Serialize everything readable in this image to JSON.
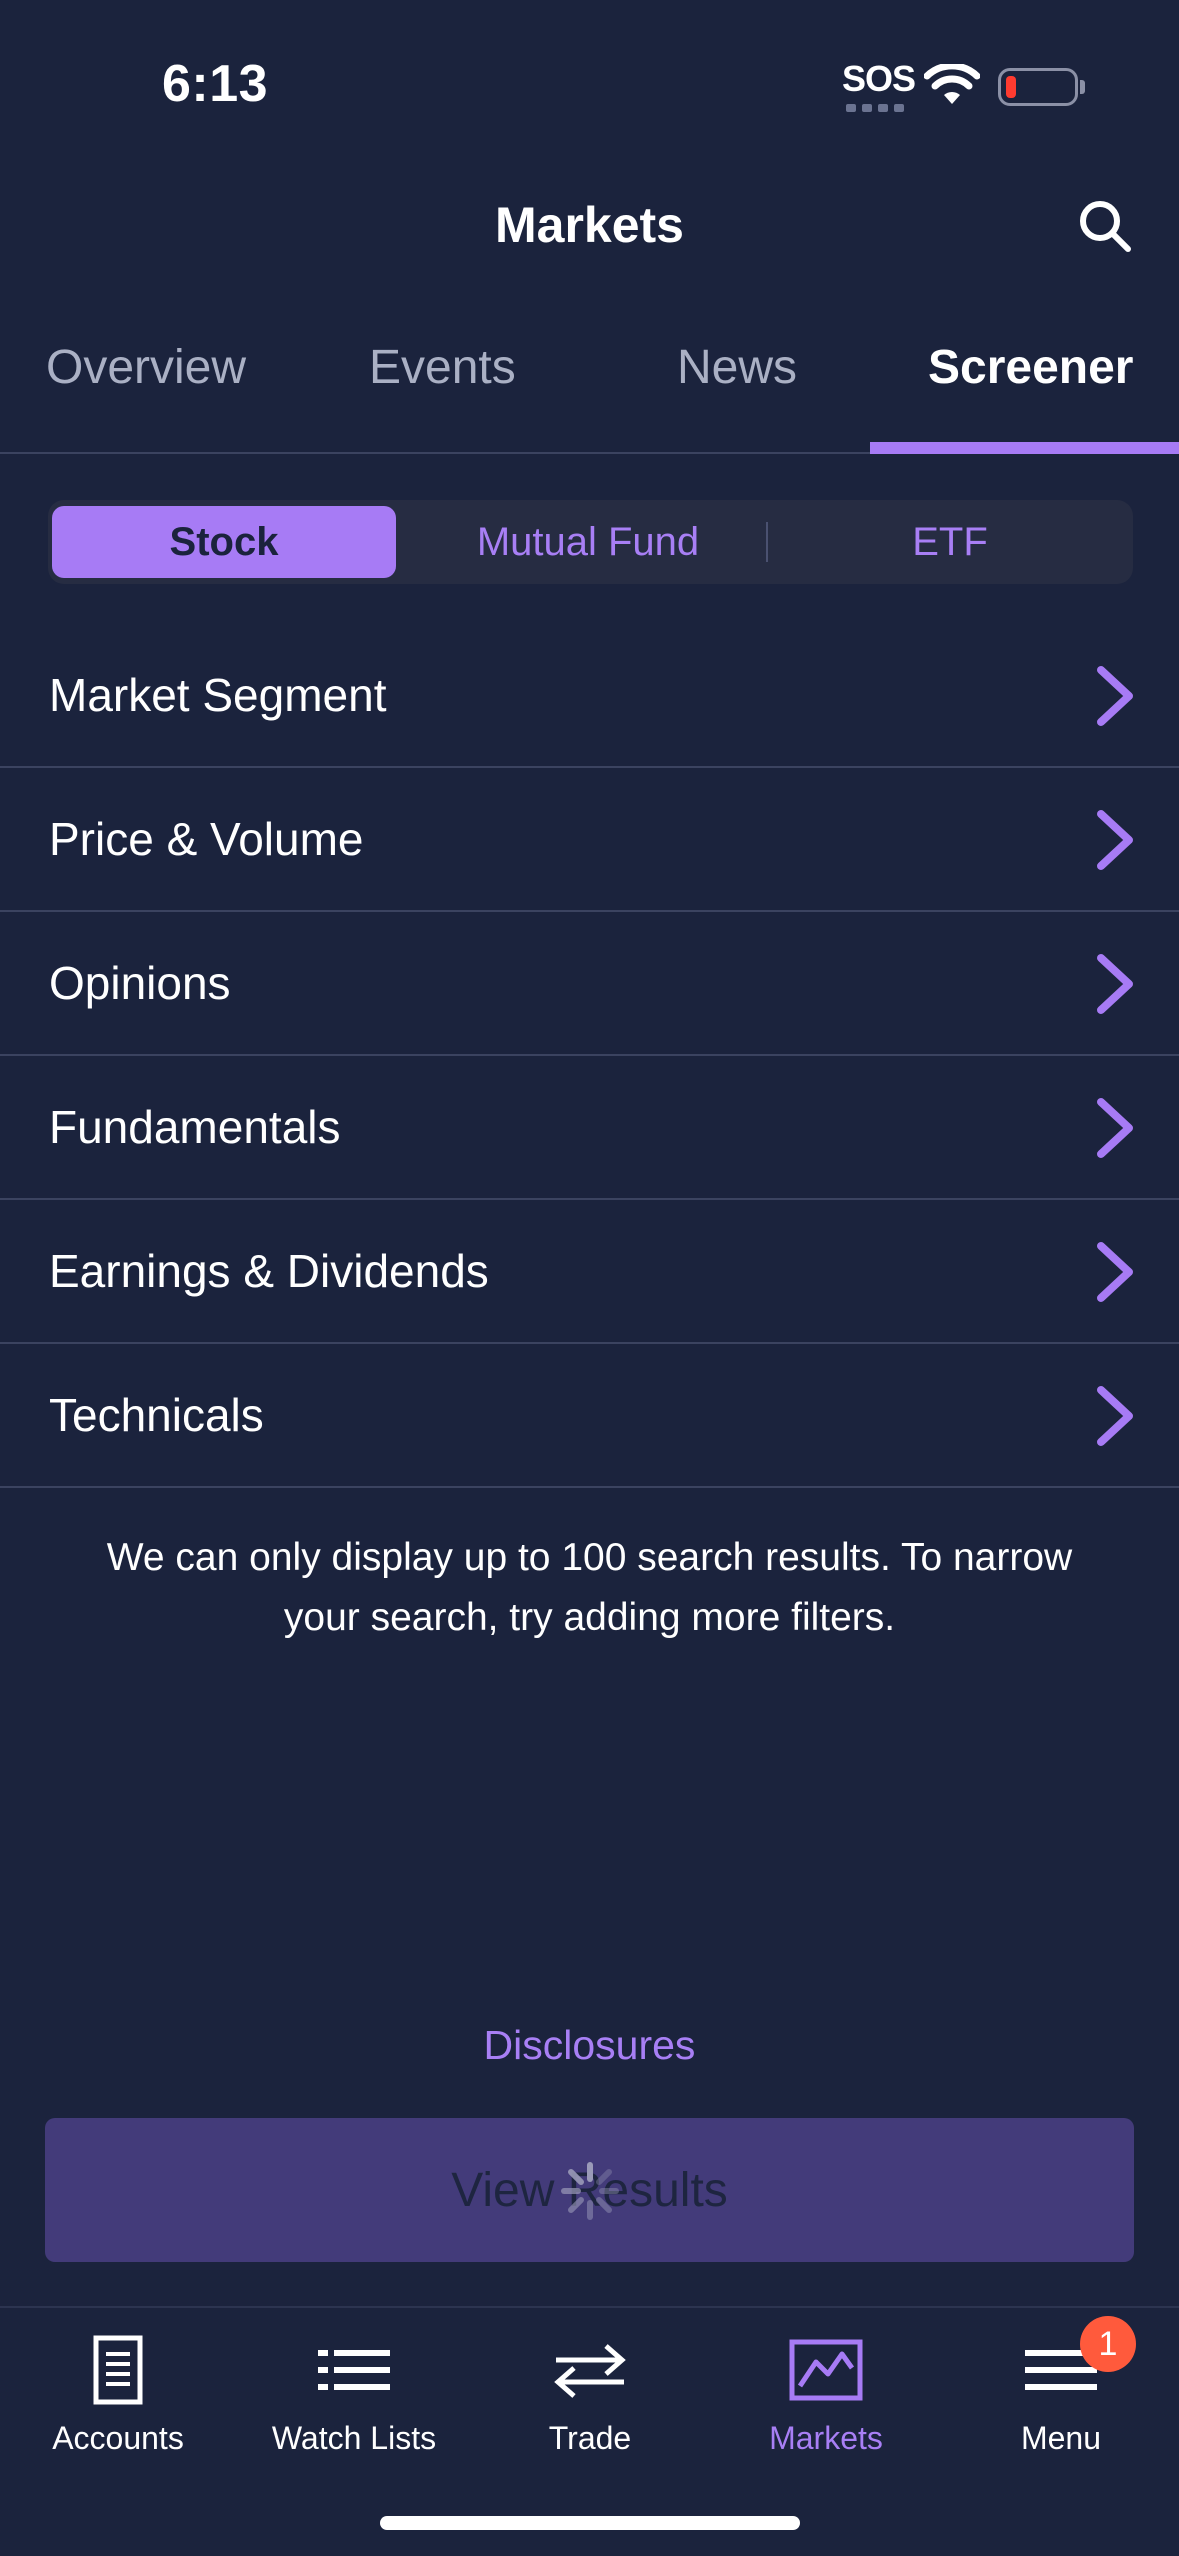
{
  "status_bar": {
    "time": "6:13",
    "sos": "SOS"
  },
  "header": {
    "title": "Markets"
  },
  "tabs": [
    {
      "label": "Overview"
    },
    {
      "label": "Events"
    },
    {
      "label": "News"
    },
    {
      "label": "Screener",
      "active": true
    }
  ],
  "segmented": {
    "options": [
      {
        "label": "Stock",
        "active": true
      },
      {
        "label": "Mutual Fund"
      },
      {
        "label": "ETF"
      }
    ]
  },
  "filters": [
    {
      "label": "Market Segment"
    },
    {
      "label": "Price & Volume"
    },
    {
      "label": "Opinions"
    },
    {
      "label": "Fundamentals"
    },
    {
      "label": "Earnings & Dividends"
    },
    {
      "label": "Technicals"
    }
  ],
  "note": "We can only display up to 100 search results. To narrow your search, try adding more filters.",
  "disclosures_label": "Disclosures",
  "view_results_label": "View Results",
  "bottom_nav": {
    "items": [
      {
        "label": "Accounts",
        "icon": "document-icon"
      },
      {
        "label": "Watch Lists",
        "icon": "list-icon"
      },
      {
        "label": "Trade",
        "icon": "swap-arrows-icon"
      },
      {
        "label": "Markets",
        "icon": "chart-icon",
        "active": true
      },
      {
        "label": "Menu",
        "icon": "hamburger-icon"
      }
    ],
    "menu_badge": "1"
  },
  "colors": {
    "background": "#1b233d",
    "accent": "#a77bf5",
    "button_disabled": "#433b7a",
    "badge": "#ff5a3c"
  }
}
